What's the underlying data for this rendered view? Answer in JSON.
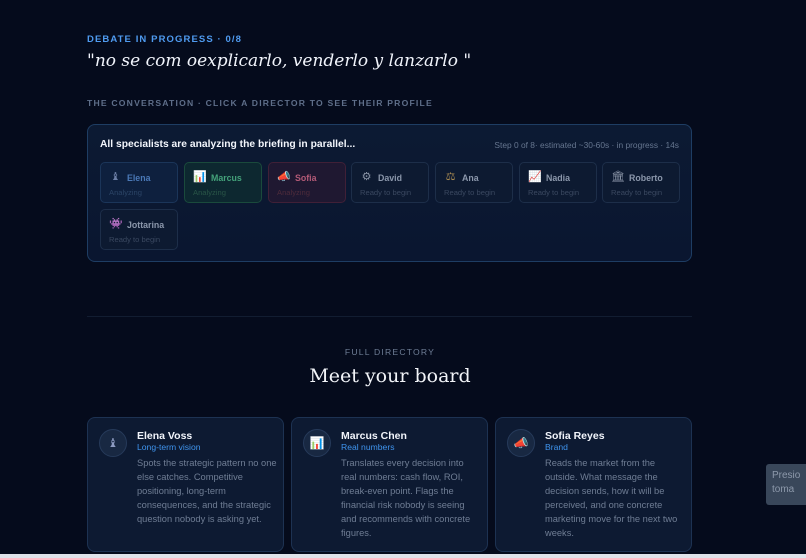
{
  "header": {
    "status": "DEBATE IN PROGRESS · 0/8",
    "quote": "\"no se com oexplicarlo, venderlo y lanzarlo \""
  },
  "conversation": {
    "label": "THE CONVERSATION · CLICK A DIRECTOR TO SEE THEIR PROFILE",
    "panel_title": "All specialists are analyzing the briefing in parallel...",
    "step_info": "Step 0 of 8· estimated ~30-60s · in progress · 14s",
    "chips": [
      {
        "name": "Elena",
        "status": "Analyzing",
        "icon": "chess-king-icon",
        "glyph": "♝"
      },
      {
        "name": "Marcus",
        "status": "Analyzing",
        "icon": "bar-chart-icon",
        "glyph": "📊"
      },
      {
        "name": "Sofia",
        "status": "Analyzing",
        "icon": "megaphone-icon",
        "glyph": "📣"
      },
      {
        "name": "David",
        "status": "Ready to begin",
        "icon": "gear-icon",
        "glyph": "⚙"
      },
      {
        "name": "Ana",
        "status": "Ready to begin",
        "icon": "scales-icon",
        "glyph": "⚖"
      },
      {
        "name": "Nadia",
        "status": "Ready to begin",
        "icon": "trend-chart-icon",
        "glyph": "📈"
      },
      {
        "name": "Roberto",
        "status": "Ready to begin",
        "icon": "bank-icon",
        "glyph": "🏛"
      },
      {
        "name": "Jottarina",
        "status": "Ready to begin",
        "icon": "mask-icon",
        "glyph": "👾"
      }
    ]
  },
  "directory": {
    "label": "FULL DIRECTORY",
    "title": "Meet your board",
    "cards": [
      {
        "name": "Elena Voss",
        "role": "Long-term vision",
        "icon": "chess-king-icon",
        "glyph": "♝",
        "description": "Spots the strategic pattern no one else catches. Competitive positioning, long-term consequences, and the strategic question nobody is asking yet."
      },
      {
        "name": "Marcus Chen",
        "role": "Real numbers",
        "icon": "bar-chart-icon",
        "glyph": "📊",
        "description": "Translates every decision into real numbers: cash flow, ROI, break-even point. Flags the financial risk nobody is seeing and recommends with concrete figures."
      },
      {
        "name": "Sofia Reyes",
        "role": "Brand",
        "icon": "megaphone-icon",
        "glyph": "📣",
        "description": "Reads the market from the outside. What message the decision sends, how it will be perceived, and one concrete marketing move for the next two weeks."
      }
    ]
  },
  "side_tab": {
    "line1": "Presio",
    "line2": "toma"
  },
  "colors": {
    "background": "#050b1c",
    "accent": "#4f9bf0",
    "role": "#3f94ee"
  }
}
